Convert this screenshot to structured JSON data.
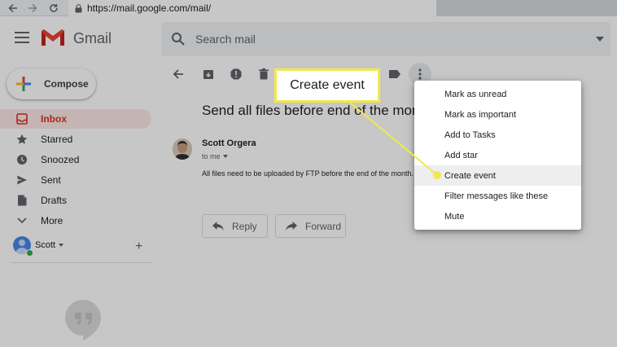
{
  "browser": {
    "url": "https://mail.google.com/mail/"
  },
  "header": {
    "app_name": "Gmail",
    "search_placeholder": "Search mail"
  },
  "sidebar": {
    "compose_label": "Compose",
    "items": [
      {
        "label": "Inbox",
        "icon": "inbox-icon",
        "active": true
      },
      {
        "label": "Starred",
        "icon": "star-icon"
      },
      {
        "label": "Snoozed",
        "icon": "clock-icon"
      },
      {
        "label": "Sent",
        "icon": "send-icon"
      },
      {
        "label": "Drafts",
        "icon": "draft-icon"
      },
      {
        "label": "More",
        "icon": "chevron-down-icon"
      }
    ],
    "user_name": "Scott",
    "add_account": "+"
  },
  "email": {
    "subject": "Send all files before end of the month",
    "sender": "Scott Orgera",
    "recipient": "to me",
    "body": "All files need to be uploaded by FTP before the end of the month.",
    "reply_label": "Reply",
    "forward_label": "Forward"
  },
  "menu": {
    "items": [
      "Mark as unread",
      "Mark as important",
      "Add to Tasks",
      "Add star",
      "Create event",
      "Filter messages like these",
      "Mute"
    ],
    "highlighted": "Create event"
  },
  "callout": {
    "label": "Create event",
    "color": "#f1e94a"
  },
  "colors": {
    "accent_red": "#d93025",
    "active_bg": "#fce8e6"
  }
}
